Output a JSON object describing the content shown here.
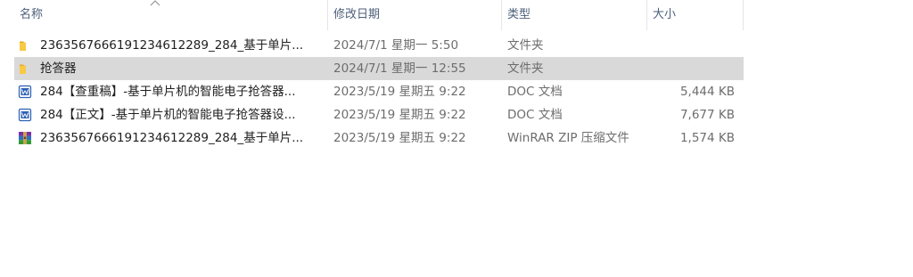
{
  "columns": {
    "name": "名称",
    "date": "修改日期",
    "type": "类型",
    "size": "大小"
  },
  "files": [
    {
      "icon": "folder-icon",
      "name": "2363567666191234612289_284_基于单片...",
      "date": "2024/7/1 星期一 5:50",
      "type": "文件夹",
      "size": ""
    },
    {
      "icon": "folder-icon",
      "name": "抢答器",
      "date": "2024/7/1 星期一 12:55",
      "type": "文件夹",
      "size": "",
      "selected": true
    },
    {
      "icon": "word-doc-icon",
      "name": "284【查重稿】-基于单片机的智能电子抢答器...",
      "date": "2023/5/19 星期五 9:22",
      "type": "DOC 文档",
      "size": "5,444 KB"
    },
    {
      "icon": "word-doc-icon",
      "name": "284【正文】-基于单片机的智能电子抢答器设...",
      "date": "2023/5/19 星期五 9:22",
      "type": "DOC 文档",
      "size": "7,677 KB"
    },
    {
      "icon": "winrar-archive-icon",
      "name": "2363567666191234612289_284_基于单片...",
      "date": "2023/5/19 星期五 9:22",
      "type": "WinRAR ZIP 压缩文件",
      "size": "1,574 KB"
    }
  ]
}
